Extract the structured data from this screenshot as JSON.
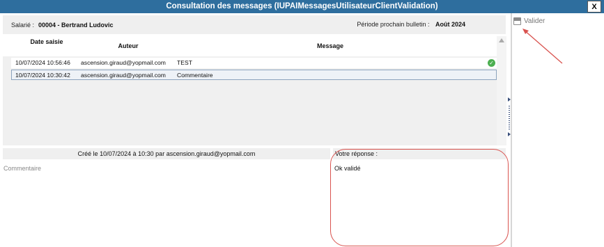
{
  "window": {
    "title": "Consultation des messages (IUPAIMessagesUtilisateurClientValidation)",
    "close_label": "X"
  },
  "header": {
    "salarie_label": "Salarié :",
    "salarie_value": "00004 - Bertrand Ludovic",
    "period_label": "Période prochain bulletin :",
    "period_value": "Août 2024"
  },
  "grid": {
    "columns": [
      "Date saisie",
      "Auteur",
      "Message"
    ],
    "rows": [
      {
        "date": "10/07/2024 10:56:46",
        "author": "ascension.giraud@yopmail.com",
        "message": "TEST",
        "validated": true
      },
      {
        "date": "10/07/2024 10:30:42",
        "author": "ascension.giraud@yopmail.com",
        "message": "Commentaire",
        "validated": false
      }
    ]
  },
  "detail": {
    "created_text": "Créé le 10/07/2024 à 10:30 par ascension.giraud@yopmail.com",
    "comment_text": "Commentaire",
    "reply_label": "Votre réponse :",
    "reply_text": "Ok validé"
  },
  "side": {
    "valider_label": "Valider",
    "save_icon": "save-icon"
  },
  "colors": {
    "titlebar": "#2e6e9e",
    "annotation": "#d9534f",
    "check": "#4caf50"
  }
}
